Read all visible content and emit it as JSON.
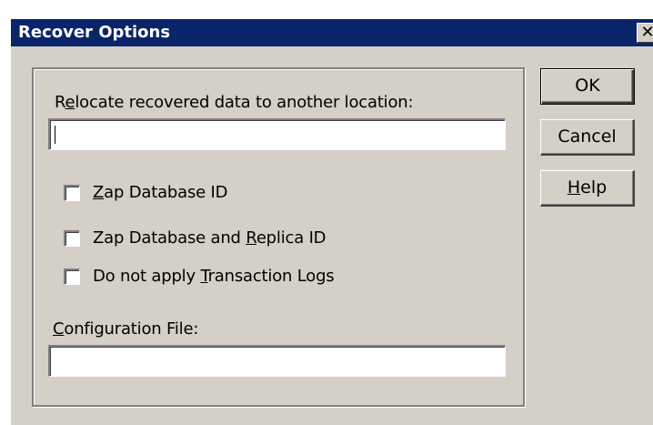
{
  "window": {
    "title": "Recover Options",
    "close_glyph": "✕"
  },
  "relocate": {
    "label_pre": "R",
    "label_accel": "e",
    "label_post": "locate recovered data to another location:",
    "value": ""
  },
  "options": {
    "zap_db": {
      "accel": "Z",
      "rest": "ap Database ID",
      "checked": false
    },
    "zap_db_replica": {
      "pre": "Zap Database and ",
      "accel": "R",
      "rest": "eplica ID",
      "checked": false
    },
    "no_logs": {
      "pre": "Do not apply ",
      "accel": "T",
      "rest": "ransaction Logs",
      "checked": false
    }
  },
  "config": {
    "label_accel": "C",
    "label_rest": "onfiguration File:",
    "value": ""
  },
  "buttons": {
    "ok": "OK",
    "cancel": "Cancel",
    "help_accel": "H",
    "help_rest": "elp"
  }
}
